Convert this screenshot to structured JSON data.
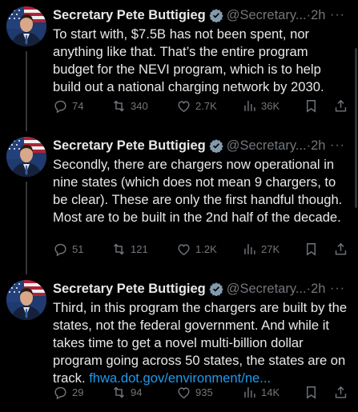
{
  "colors": {
    "background": "#000000",
    "text": "#e7e9ea",
    "muted": "#71767b",
    "link": "#1d9bf0",
    "verified": "#829aab"
  },
  "tweets": [
    {
      "author": "Secretary Pete Buttigieg",
      "handle": "@Secretary...",
      "dot": "·",
      "time": "2h",
      "more": "···",
      "text": "To start with, $7.5B has not been spent, nor anything like that. That’s the entire program budget for the NEVI program, which is to help build out a national charging network by 2030.",
      "link": "",
      "replies": "74",
      "reposts": "340",
      "likes": "2.7K",
      "views": "36K"
    },
    {
      "author": "Secretary Pete Buttigieg",
      "handle": "@Secretary...",
      "dot": "·",
      "time": "2h",
      "more": "···",
      "text": "Secondly, there are chargers now operational in nine states (which does not mean 9 chargers, to be clear). These are only the first handful though. Most are to be built in the 2nd half of the decade.",
      "link": "",
      "replies": "51",
      "reposts": "121",
      "likes": "1.2K",
      "views": "27K"
    },
    {
      "author": "Secretary Pete Buttigieg",
      "handle": "@Secretary...",
      "dot": "·",
      "time": "2h",
      "more": "···",
      "text": "Third, in this program the chargers are built by the states, not the federal government. And while it takes time to get a novel multi-billion dollar program going across 50 states, the states are on track. ",
      "link": "fhwa.dot.gov/environment/ne...",
      "replies": "29",
      "reposts": "94",
      "likes": "935",
      "views": "14K"
    }
  ],
  "icons": {
    "reply": "reply-icon",
    "repost": "repost-icon",
    "like": "heart-icon",
    "views": "views-icon",
    "bookmark": "bookmark-icon",
    "share": "share-icon",
    "verified": "verified-badge-icon"
  }
}
